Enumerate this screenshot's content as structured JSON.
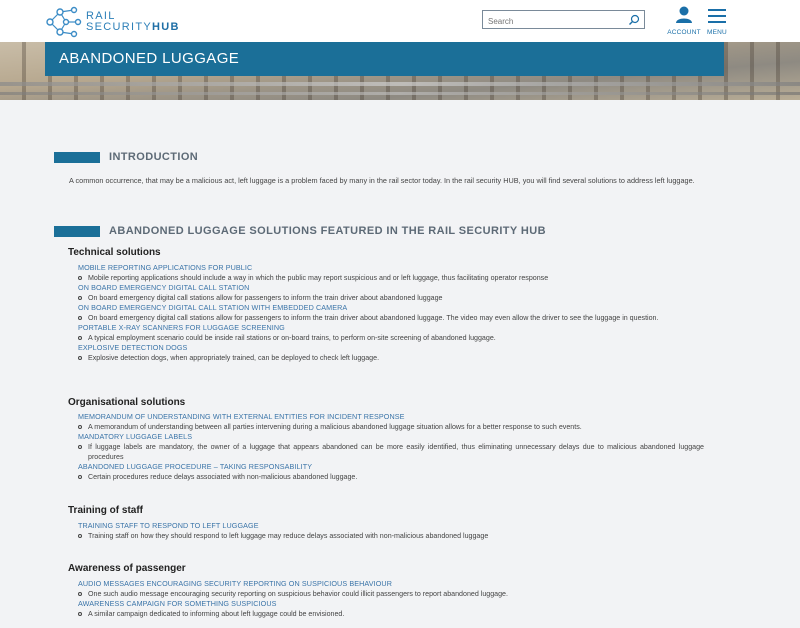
{
  "header": {
    "logo_line1": "RAIL",
    "logo_line2a": "SECURITY",
    "logo_line2b": "HUB",
    "search_placeholder": "Search",
    "account_label": "ACCOUNT",
    "menu_label": "MENU"
  },
  "page_title": "ABANDONED LUGGAGE",
  "intro": {
    "heading": "INTRODUCTION",
    "text": "A common occurrence, that may be a malicious act, left luggage is a problem faced by many in the rail sector today. In the rail security HUB, you will find several solutions to address left luggage."
  },
  "solutions": {
    "heading": "ABANDONED LUGGAGE SOLUTIONS FEATURED IN THE RAIL SECURITY HUB",
    "groups": [
      {
        "title": "Technical solutions",
        "items": [
          {
            "link": "MOBILE REPORTING APPLICATIONS FOR PUBLIC",
            "desc": "Mobile reporting applications should include a way in which the public may report suspicious and or left luggage, thus facilitating operator response"
          },
          {
            "link": "ON BOARD EMERGENCY DIGITAL CALL STATION",
            "desc": "On board emergency digital call stations allow for passengers to inform the train driver about abandoned luggage"
          },
          {
            "link": "ON BOARD EMERGENCY DIGITAL CALL STATION WITH EMBEDDED CAMERA",
            "desc": "On board emergency digital call stations allow for passengers to inform the train driver about abandoned luggage. The video may even allow the driver to see the luggage in question."
          },
          {
            "link": "PORTABLE X-RAY SCANNERS FOR LUGGAGE SCREENING",
            "desc": "A typical employment scenario could be inside rail stations or on-board trains, to perform on-site screening of abandoned luggage."
          },
          {
            "link": "EXPLOSIVE DETECTION DOGS",
            "desc": "Explosive detection dogs, when appropriately trained, can be deployed to check left luggage."
          }
        ]
      },
      {
        "title": "Organisational solutions",
        "items": [
          {
            "link": "MEMORANDUM OF UNDERSTANDING WITH EXTERNAL ENTITIES FOR INCIDENT RESPONSE",
            "desc": "A memorandum of understanding between all parties intervening during a malicious abandoned luggage situation allows for a better response to such events."
          },
          {
            "link": "MANDATORY LUGGAGE LABELS",
            "desc": "If luggage labels are mandatory, the owner of a luggage that appears abandoned can be more easily identified, thus eliminating unnecessary delays due to malicious abandoned luggage procedures"
          },
          {
            "link": "ABANDONED LUGGAGE PROCEDURE – TAKING RESPONSABILITY",
            "desc": "Certain procedures reduce delays associated with non-malicious abandoned luggage."
          }
        ]
      },
      {
        "title": "Training of staff",
        "items": [
          {
            "link": "TRAINING STAFF TO RESPOND TO LEFT LUGGAGE",
            "desc": "Training staff on how they should respond to left luggage may reduce delays associated with non-malicious abandoned luggage"
          }
        ]
      },
      {
        "title": "Awareness of passenger",
        "items": [
          {
            "link": "AUDIO MESSAGES ENCOURAGING SECURITY REPORTING ON SUSPICIOUS BEHAVIOUR",
            "desc": "One such audio message encouraging security reporting on suspicious behavior could illicit passengers to report abandoned luggage."
          },
          {
            "link": "AWARENESS CAMPAIGN FOR SOMETHING SUSPICIOUS",
            "desc": "A similar campaign dedicated to informing about left luggage could be envisioned."
          }
        ]
      }
    ]
  },
  "colors": {
    "brand": "#1b6f98",
    "link": "#3a74a8",
    "heading": "#5d6a76"
  }
}
